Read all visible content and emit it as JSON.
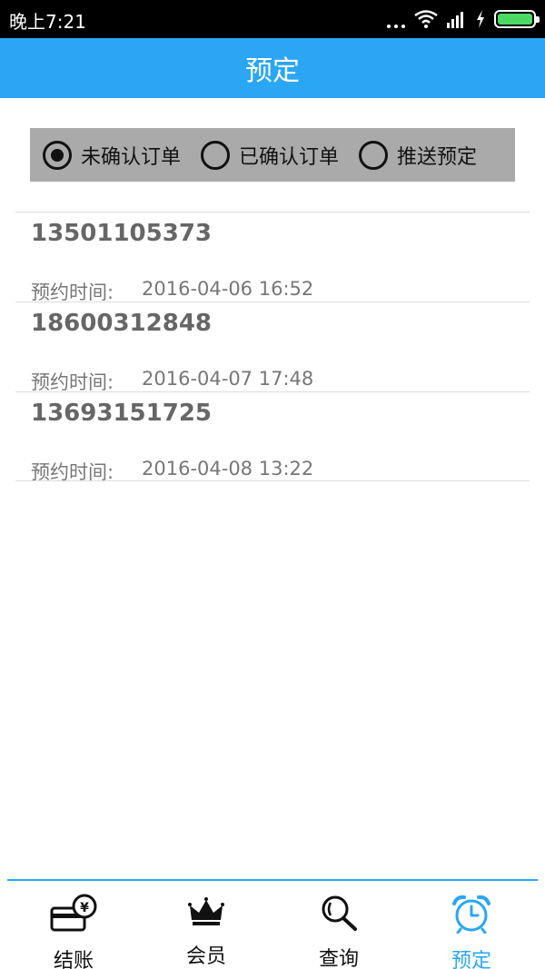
{
  "status_bar": {
    "time": "晚上7:21",
    "icons": [
      "more-dots-icon",
      "wifi-icon",
      "signal-icon",
      "charging-icon",
      "battery-icon"
    ]
  },
  "header": {
    "title": "预定"
  },
  "filter": {
    "options": [
      {
        "label": "未确认订单",
        "checked": true
      },
      {
        "label": "已确认订单",
        "checked": false
      },
      {
        "label": "推送预定",
        "checked": false
      }
    ]
  },
  "orders": [
    {
      "phone": "13501105373",
      "time_label": "预约时间:",
      "time": "2016-04-06 16:52"
    },
    {
      "phone": "18600312848",
      "time_label": "预约时间:",
      "time": "2016-04-07 17:48"
    },
    {
      "phone": "13693151725",
      "time_label": "预约时间:",
      "time": "2016-04-08 13:22"
    }
  ],
  "bottom_nav": {
    "items": [
      {
        "label": "结账",
        "icon": "card-yuan-icon",
        "active": false
      },
      {
        "label": "会员",
        "icon": "crown-icon",
        "active": false
      },
      {
        "label": "查询",
        "icon": "magnifier-icon",
        "active": false
      },
      {
        "label": "预定",
        "icon": "alarm-clock-icon",
        "active": true
      }
    ]
  },
  "colors": {
    "accent": "#2aa6f5",
    "filter_bg": "#aaaaaa",
    "battery": "#4cd964"
  }
}
